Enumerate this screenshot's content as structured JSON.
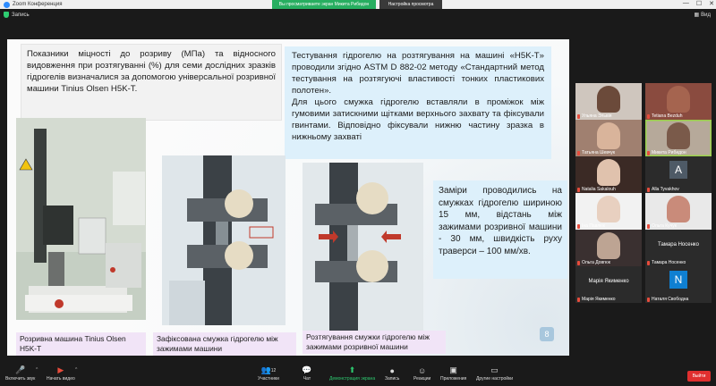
{
  "window": {
    "title": "Zoom Конференция",
    "minimize": "—",
    "maximize": "☐",
    "close": "✕"
  },
  "topbar": {
    "share_banner": "Вы просматриваете экран Микита Рибидон",
    "view_options": "Настройка просмотра",
    "secure_label": "Запись",
    "view_label": "Вид"
  },
  "slide": {
    "box1_text": "Показники міцності до розриву (МПа) та відносного видовження при розтягуванні (%) для семи дослідних зразків гідрогелів визначалися за допомогою універсальної розривної машини Tinius Olsen H5K-T.",
    "box2_p1": "Тестування гідрогелю на розтягування на машині «H5K-T» проводили згідно ASTM D 882-02 методу «Стандартний метод тестування на розтягуючі властивості тонких пластикових полотен».",
    "box2_p2": "Для цього смужка гідрогелю вставляли в проміжок між гумовими затискними щітками верхнього захвату та фіксували гвинтами. Відповідно фіксували нижню частину зразка в нижньому захваті",
    "box3_text": "Заміри проводились на смужках гідрогелю шириною 15 мм, відстань між зажимами розривної машини - 30 мм, швидкість руху траверси – 100 мм/хв.",
    "cap1": "Розривна машина Tinius Olsen H5K-T",
    "cap2": "Зафіксована смужка гідрогелю між зажимами машини",
    "cap3": "Розтягування смужки гідрогелю між зажимами розривної машини",
    "page_number": "8"
  },
  "gallery": [
    {
      "name": "Ульяна Эльвія",
      "type": "video",
      "face": "#6b4a3a",
      "bg": "#cfc6be"
    },
    {
      "name": "Tetiana Bezduh",
      "type": "video",
      "face": "#a5644f",
      "bg": "#8a4b3f"
    },
    {
      "name": "Татьяна Шевчук",
      "type": "video",
      "face": "#d9b49b",
      "bg": "#a08070"
    },
    {
      "name": "Микита Рибидон",
      "type": "video",
      "face": "#7a5a4a",
      "bg": "#b6a99a",
      "active": true
    },
    {
      "name": "Natalia Sakalouh",
      "type": "video",
      "face": "#e0c2ad",
      "bg": "#3b2a25"
    },
    {
      "name": "Alla Tyvakhov",
      "type": "avatar",
      "letter": "A",
      "color": "#4e5a66"
    },
    {
      "name": "Іна Павлюк",
      "type": "video",
      "face": "#e8d0c0",
      "bg": "#f2f2f2"
    },
    {
      "name": "Ольга Кучук",
      "type": "video",
      "face": "#c98b7a",
      "bg": "#e9e9e9"
    },
    {
      "name": "Ольга Довгюк",
      "type": "video",
      "face": "#bda493",
      "bg": "#3a3030"
    },
    {
      "name": "Тамара Носенко",
      "type": "name",
      "label": "Тамара Носенко"
    },
    {
      "name": "Марія Якименко",
      "type": "name",
      "label": "Марія Якименко"
    },
    {
      "name": "Наталя Свободна",
      "type": "avatar",
      "letter": "N",
      "color": "#0f7fd1"
    }
  ],
  "toolbar": {
    "mute": "Включить звук",
    "video": "Начать видео",
    "participants": "Участники",
    "participants_count": "12",
    "chat": "Чат",
    "share": "Демонстрация экрана",
    "record": "Запись",
    "reactions": "Реакции",
    "apps": "Приложения",
    "more": "Другие настройки",
    "end": "Выйти"
  }
}
